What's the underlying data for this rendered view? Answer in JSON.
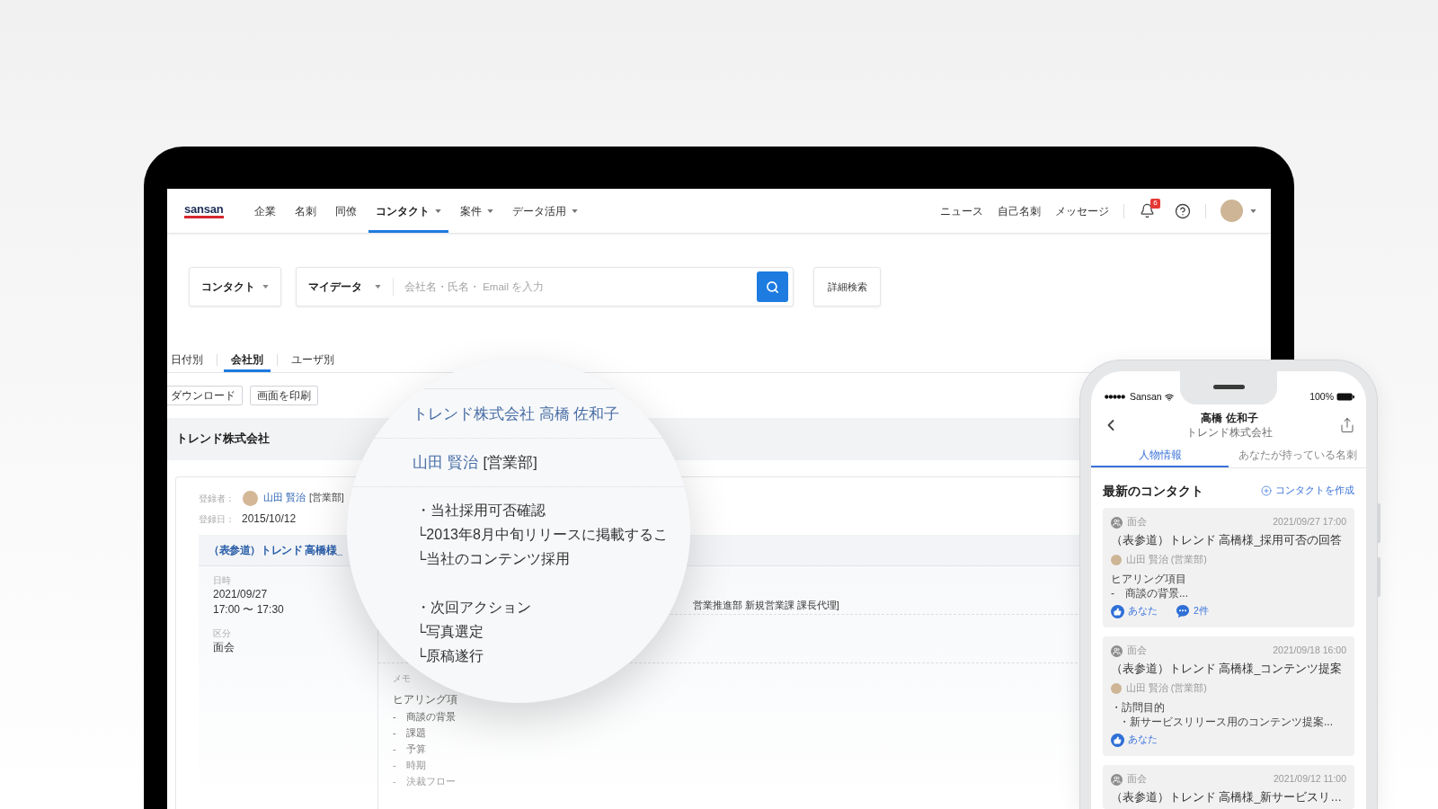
{
  "nav": {
    "logo": "sansan",
    "items": [
      {
        "label": "企業",
        "selected": false,
        "dropdown": false
      },
      {
        "label": "名刺",
        "selected": false,
        "dropdown": false
      },
      {
        "label": "同僚",
        "selected": false,
        "dropdown": false
      },
      {
        "label": "コンタクト",
        "selected": true,
        "dropdown": true
      },
      {
        "label": "案件",
        "selected": false,
        "dropdown": true
      },
      {
        "label": "データ活用",
        "selected": false,
        "dropdown": true
      }
    ],
    "links": [
      "ニュース",
      "自己名刺",
      "メッセージ"
    ],
    "notification_count": "6"
  },
  "search": {
    "scope": "コンタクト",
    "source": "マイデータ",
    "placeholder": "会社名・氏名・ Email を入力",
    "advanced_button": "詳細検索"
  },
  "view_tabs": [
    {
      "label": "日付別",
      "selected": false
    },
    {
      "label": "会社別",
      "selected": true
    },
    {
      "label": "ユーザ別",
      "selected": false
    }
  ],
  "actions": [
    "ダウンロード",
    "画面を印刷"
  ],
  "company": "トレンド株式会社",
  "record": {
    "registrant_label": "登録者：",
    "registrant_name": "山田 賢治",
    "registrant_dept": "[営業部]",
    "date_label": "登録日：",
    "date": "2015/10/12",
    "contact_title": "（表参道）トレンド 高橋様_",
    "details": [
      {
        "label": "日時",
        "lines": [
          "2021/09/27",
          "17:00 〜 17:30"
        ]
      },
      {
        "label": "区分",
        "lines": [
          "面会"
        ]
      }
    ],
    "attendee": "営業推進部 新規営業課 課長代理]",
    "memo_label": "メモ",
    "memo_heading": "ヒアリング項",
    "memo_items": [
      "-　商談の背景",
      "-　課題",
      "-　予算",
      "-　時期",
      "-　決裁フロー"
    ]
  },
  "magnifier": {
    "company_person": "トレンド株式会社 高橋 佐和子",
    "user_name": "山田 賢治",
    "user_dept": "[営業部]",
    "note_groups": [
      [
        "・当社採用可否確認",
        "└2013年8月中旬リリースに掲載するこ",
        "└当社のコンテンツ採用"
      ],
      [
        "・次回アクション",
        "└写真選定",
        "└原稿遂行"
      ]
    ]
  },
  "phone": {
    "carrier": "Sansan",
    "battery": "100%",
    "title": "高橋 佐和子",
    "subtitle": "トレンド株式会社",
    "tabs": [
      {
        "label": "人物情報",
        "selected": true
      },
      {
        "label": "あなたが持っている名刺",
        "selected": false
      }
    ],
    "section_title": "最新のコンタクト",
    "create_link": "コンタクトを作成",
    "contacts": [
      {
        "type": "面会",
        "datetime": "2021/09/27 17:00",
        "title": "（表参道）トレンド 高橋様_採用可否の回答",
        "author": "山田 賢治 (営業部)",
        "body": [
          {
            "text": "ヒアリング項目"
          },
          {
            "text": "-　商談の背景..."
          }
        ],
        "like": "あなた",
        "comments": "2件"
      },
      {
        "type": "面会",
        "datetime": "2021/09/18 16:00",
        "title": "（表参道）トレンド 高橋様_コンテンツ提案",
        "author": "山田 賢治 (営業部)",
        "body": [
          {
            "text": "・訪問目的",
            "children": [
              {
                "text": "・新サービスリリース用のコンテンツ提案..."
              }
            ]
          }
        ],
        "like": "あなた"
      },
      {
        "type": "面会",
        "datetime": "2021/09/12 11:00",
        "title": "（表参道）トレンド 高橋様_新サービスリ…"
      }
    ]
  }
}
